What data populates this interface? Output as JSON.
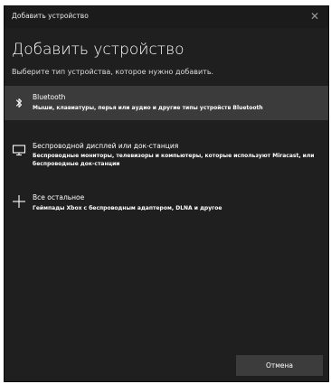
{
  "window": {
    "title": "Добавить устройство",
    "close_glyph": "✕"
  },
  "header": {
    "heading": "Добавить устройство",
    "subtitle": "Выберите тип устройства, которое нужно добавить."
  },
  "options": [
    {
      "icon": "bluetooth-icon",
      "title": "Bluetooth",
      "description": "Мыши, клавиатуры, перья или аудио и другие типы устройств Bluetooth",
      "selected": true
    },
    {
      "icon": "monitor-icon",
      "title": "Беспроводной дисплей или док-станция",
      "description": "Беспроводные мониторы, телевизоры и компьютеры, которые используют Miracast, или беспроводные док-станции",
      "selected": false
    },
    {
      "icon": "plus-icon",
      "title": "Все остальное",
      "description": "Геймпады Xbox с беспроводным адаптером, DLNA и другое",
      "selected": false
    }
  ],
  "footer": {
    "cancel_label": "Отмена"
  },
  "colors": {
    "window_bg": "#1f1f1f",
    "selected_row": "#3b3b3b",
    "button_bg": "#3c3c3c"
  }
}
